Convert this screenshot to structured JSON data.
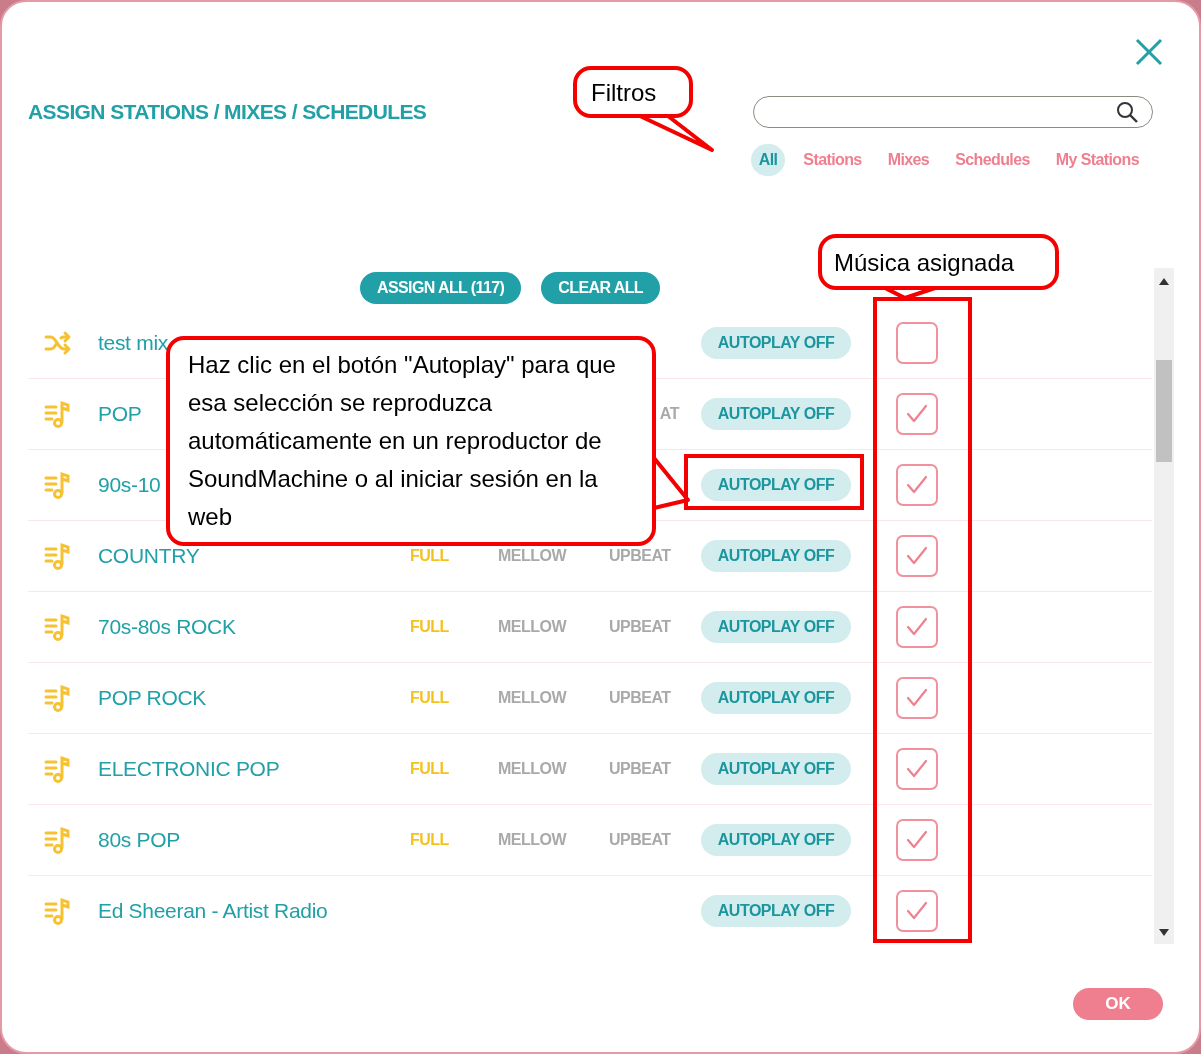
{
  "title": "ASSIGN STATIONS / MIXES / SCHEDULES",
  "filters": [
    {
      "label": "All",
      "selected": true
    },
    {
      "label": "Stations",
      "selected": false
    },
    {
      "label": "Mixes",
      "selected": false
    },
    {
      "label": "Schedules",
      "selected": false
    },
    {
      "label": "My Stations",
      "selected": false
    }
  ],
  "actions": [
    "ASSIGN ALL (117)",
    "CLEAR ALL"
  ],
  "items": [
    {
      "kind": "mix",
      "name": "test mix",
      "autoplay": "AUTOPLAY OFF",
      "checked": false
    },
    {
      "kind": "station",
      "name": "POP",
      "tags": [
        {
          "kind": "upbeat",
          "text": "AT"
        }
      ],
      "autoplay": "AUTOPLAY OFF",
      "checked": true
    },
    {
      "kind": "station",
      "name": "90s-10",
      "autoplay": "AUTOPLAY OFF",
      "checked": true
    },
    {
      "kind": "station",
      "name": "COUNTRY",
      "tags": [
        {
          "kind": "full",
          "text": "FULL"
        },
        {
          "kind": "mellow",
          "text": "MELLOW"
        },
        {
          "kind": "upbeat",
          "text": "UPBEAT"
        }
      ],
      "autoplay": "AUTOPLAY OFF",
      "checked": true
    },
    {
      "kind": "station",
      "name": "70s-80s ROCK",
      "tags": [
        {
          "kind": "full",
          "text": "FULL"
        },
        {
          "kind": "mellow",
          "text": "MELLOW"
        },
        {
          "kind": "upbeat",
          "text": "UPBEAT"
        }
      ],
      "autoplay": "AUTOPLAY OFF",
      "checked": true
    },
    {
      "kind": "station",
      "name": "POP ROCK",
      "tags": [
        {
          "kind": "full",
          "text": "FULL"
        },
        {
          "kind": "mellow",
          "text": "MELLOW"
        },
        {
          "kind": "upbeat",
          "text": "UPBEAT"
        }
      ],
      "autoplay": "AUTOPLAY OFF",
      "checked": true
    },
    {
      "kind": "station",
      "name": "ELECTRONIC POP",
      "tags": [
        {
          "kind": "full",
          "text": "FULL"
        },
        {
          "kind": "mellow",
          "text": "MELLOW"
        },
        {
          "kind": "upbeat",
          "text": "UPBEAT"
        }
      ],
      "autoplay": "AUTOPLAY OFF",
      "checked": true
    },
    {
      "kind": "station",
      "name": "80s POP",
      "tags": [
        {
          "kind": "full",
          "text": "FULL"
        },
        {
          "kind": "mellow",
          "text": "MELLOW"
        },
        {
          "kind": "upbeat",
          "text": "UPBEAT"
        }
      ],
      "autoplay": "AUTOPLAY OFF",
      "checked": true
    },
    {
      "kind": "station",
      "name": "Ed Sheeran - Artist Radio",
      "autoplay": "AUTOPLAY OFF",
      "checked": true
    }
  ],
  "ok": "OK",
  "annotations": [
    {
      "text": "Filtros"
    },
    {
      "text": "Música asignada"
    },
    {
      "text": "Haz clic en el botón \"Autoplay\" para que esa selección se reproduzca automáticamente en un reproductor de SoundMachine o al iniciar sesión en la web"
    }
  ]
}
